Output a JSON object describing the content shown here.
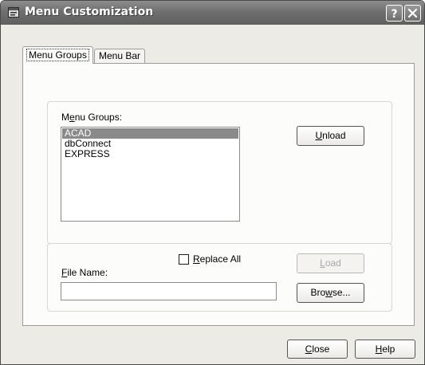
{
  "window": {
    "title": "Menu Customization",
    "icons": {
      "app": "app-menu-icon",
      "help": "help-question-icon",
      "close": "close-x-icon"
    }
  },
  "tabs": [
    {
      "pre": "",
      "key": "",
      "post": "Menu Groups",
      "active": true
    },
    {
      "pre": "",
      "key": "",
      "post": "Menu Bar",
      "active": false
    }
  ],
  "menu_groups": {
    "label": {
      "pre": "M",
      "key": "e",
      "post": "nu Groups:"
    },
    "items": [
      {
        "label": "ACAD",
        "selected": true
      },
      {
        "label": "dbConnect",
        "selected": false
      },
      {
        "label": "EXPRESS",
        "selected": false
      }
    ],
    "unload_label": {
      "pre": "",
      "key": "U",
      "post": "nload"
    }
  },
  "file": {
    "replace_all": {
      "pre": "",
      "key": "R",
      "post": "eplace All",
      "checked": false
    },
    "file_name_label": {
      "pre": "",
      "key": "F",
      "post": "ile Name:"
    },
    "file_name_value": "",
    "load_label": {
      "pre": "",
      "key": "L",
      "post": "oad",
      "enabled": false
    },
    "browse_label": {
      "pre": "Bro",
      "key": "w",
      "post": "se..."
    }
  },
  "footer": {
    "close_label": {
      "pre": "",
      "key": "C",
      "post": "lose"
    },
    "help_label": {
      "pre": "",
      "key": "H",
      "post": "elp"
    }
  },
  "colors": {
    "titlebar": "#6f6f6f",
    "dialog_bg": "#ecebe6",
    "selection": "#8a8a8a"
  }
}
